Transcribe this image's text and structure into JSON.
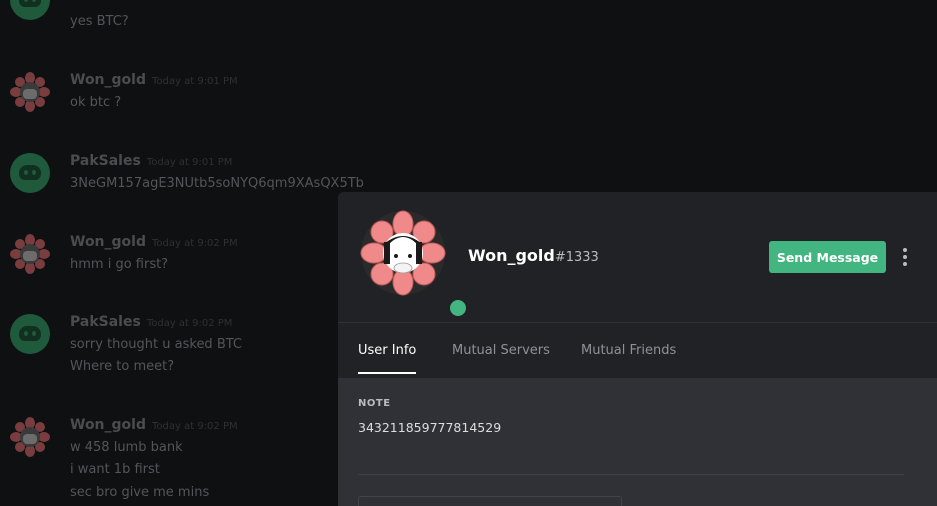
{
  "chat": {
    "messages": [
      {
        "lines": [
          "yes BTC?"
        ]
      },
      {
        "author": "Won_gold",
        "timestamp": "Today at 9:01 PM",
        "lines": [
          "ok btc ?"
        ]
      },
      {
        "author": "PakSales",
        "timestamp": "Today at 9:01 PM",
        "lines": [
          "3NeGM157agE3NUtb5soNYQ6qm9XAsQX5Tb"
        ]
      },
      {
        "author": "Won_gold",
        "timestamp": "Today at 9:02 PM",
        "lines": [
          "hmm i go first?"
        ]
      },
      {
        "author": "PakSales",
        "timestamp": "Today at 9:02 PM",
        "lines": [
          "sorry thought u asked BTC",
          "Where to meet?"
        ]
      },
      {
        "author": "Won_gold",
        "timestamp": "Today at 9:02 PM",
        "lines": [
          "w 458 lumb bank",
          "i want 1b first",
          "sec bro give me mins"
        ]
      }
    ]
  },
  "profile": {
    "username": "Won_gold",
    "discriminator": "#1333",
    "status_color": "#43b581",
    "send_message_label": "Send Message",
    "more_icon": "more-vertical-icon",
    "tabs": [
      {
        "label": "User Info"
      },
      {
        "label": "Mutual Servers"
      },
      {
        "label": "Mutual Friends"
      }
    ],
    "note_label": "NOTE",
    "note_value": "343211859777814529"
  },
  "colors": {
    "accent_green": "#43b581",
    "modal_bg": "#202225",
    "body_bg": "#2f3136"
  }
}
